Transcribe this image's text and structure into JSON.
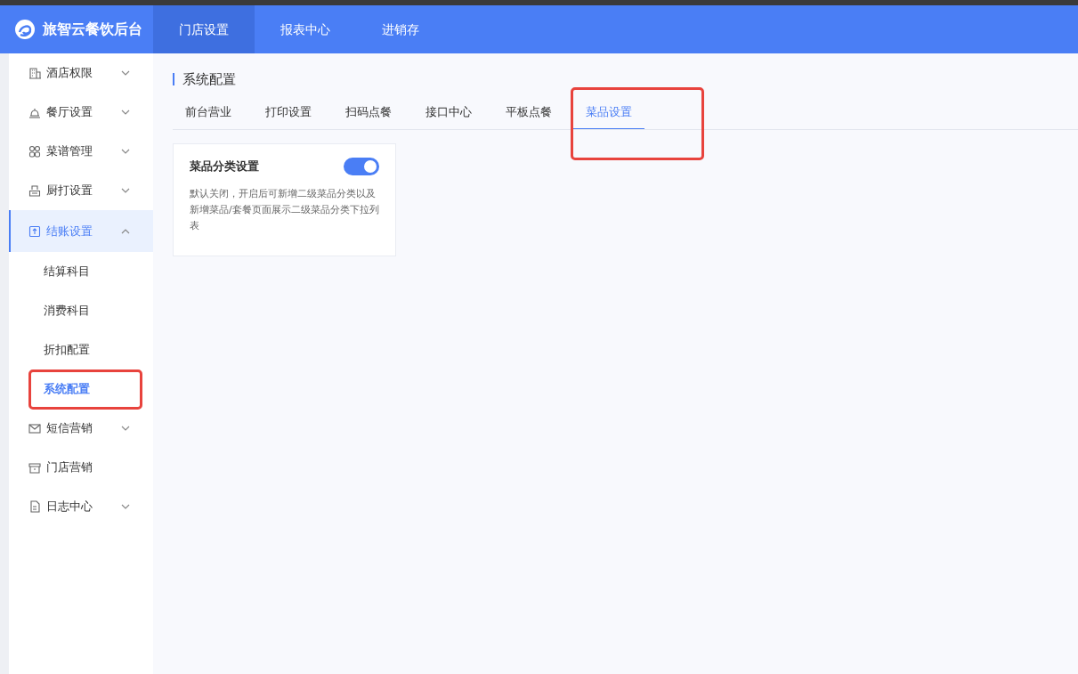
{
  "header": {
    "brand": "旅智云餐饮后台",
    "nav": [
      {
        "label": "门店设置",
        "selected": true
      },
      {
        "label": "报表中心",
        "selected": false
      },
      {
        "label": "进销存",
        "selected": false
      }
    ]
  },
  "sidebar": {
    "items": [
      {
        "label": "酒店权限",
        "kind": "group",
        "expanded": false,
        "selected": false
      },
      {
        "label": "餐厅设置",
        "kind": "group",
        "expanded": false,
        "selected": false
      },
      {
        "label": "菜谱管理",
        "kind": "group",
        "expanded": false,
        "selected": false
      },
      {
        "label": "厨打设置",
        "kind": "group",
        "expanded": false,
        "selected": false
      },
      {
        "label": "结账设置",
        "kind": "group",
        "expanded": true,
        "selected": true,
        "children": [
          {
            "label": "结算科目",
            "selected": false,
            "highlighted": false
          },
          {
            "label": "消费科目",
            "selected": false,
            "highlighted": false
          },
          {
            "label": "折扣配置",
            "selected": false,
            "highlighted": false
          },
          {
            "label": "系统配置",
            "selected": true,
            "highlighted": true
          }
        ]
      },
      {
        "label": "短信营销",
        "kind": "group",
        "expanded": false,
        "selected": false
      },
      {
        "label": "门店营销",
        "kind": "link",
        "selected": false
      },
      {
        "label": "日志中心",
        "kind": "group",
        "expanded": false,
        "selected": false
      }
    ]
  },
  "page_title": "系统配置",
  "tabs": [
    {
      "label": "前台营业",
      "selected": false,
      "highlighted": false
    },
    {
      "label": "打印设置",
      "selected": false,
      "highlighted": false
    },
    {
      "label": "扫码点餐",
      "selected": false,
      "highlighted": false
    },
    {
      "label": "接口中心",
      "selected": false,
      "highlighted": false
    },
    {
      "label": "平板点餐",
      "selected": false,
      "highlighted": false
    },
    {
      "label": "菜品设置",
      "selected": true,
      "highlighted": true
    }
  ],
  "settings": [
    {
      "title": "菜品分类设置",
      "on": true,
      "description": "默认关闭，开启后可新增二级菜品分类以及新增菜品/套餐页面展示二级菜品分类下拉列表"
    }
  ]
}
